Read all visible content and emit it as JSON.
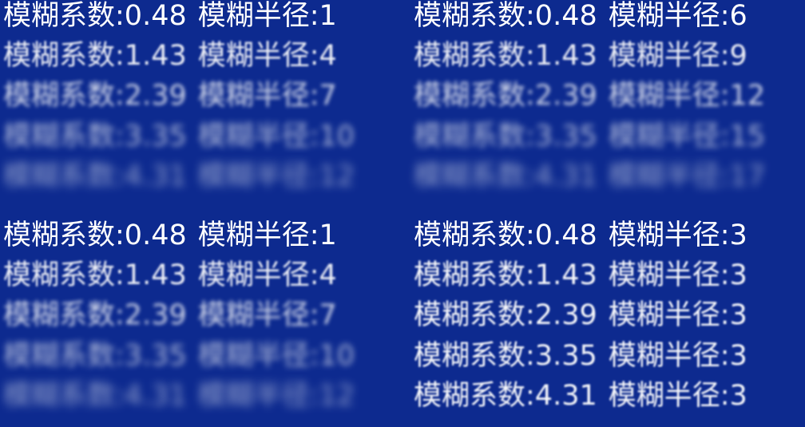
{
  "panels": [
    {
      "rows": [
        {
          "coef_label": "模糊系数:",
          "coef": "0.48",
          "radius_label": "模糊半径:",
          "radius": "1"
        },
        {
          "coef_label": "模糊系数:",
          "coef": "1.43",
          "radius_label": "模糊半径:",
          "radius": "4"
        },
        {
          "coef_label": "模糊系数:",
          "coef": "2.39",
          "radius_label": "模糊半径:",
          "radius": "7"
        },
        {
          "coef_label": "模糊系数:",
          "coef": "3.35",
          "radius_label": "模糊半径:",
          "radius": "10"
        },
        {
          "coef_label": "模糊系数:",
          "coef": "4.31",
          "radius_label": "模糊半径:",
          "radius": "12"
        }
      ]
    },
    {
      "rows": [
        {
          "coef_label": "模糊系数:",
          "coef": "0.48",
          "radius_label": "模糊半径:",
          "radius": "6"
        },
        {
          "coef_label": "模糊系数:",
          "coef": "1.43",
          "radius_label": "模糊半径:",
          "radius": "9"
        },
        {
          "coef_label": "模糊系数:",
          "coef": "2.39",
          "radius_label": "模糊半径:",
          "radius": "12"
        },
        {
          "coef_label": "模糊系数:",
          "coef": "3.35",
          "radius_label": "模糊半径:",
          "radius": "15"
        },
        {
          "coef_label": "模糊系数:",
          "coef": "4.31",
          "radius_label": "模糊半径:",
          "radius": "17"
        }
      ]
    },
    {
      "rows": [
        {
          "coef_label": "模糊系数:",
          "coef": "0.48",
          "radius_label": "模糊半径:",
          "radius": "1"
        },
        {
          "coef_label": "模糊系数:",
          "coef": "1.43",
          "radius_label": "模糊半径:",
          "radius": "4"
        },
        {
          "coef_label": "模糊系数:",
          "coef": "2.39",
          "radius_label": "模糊半径:",
          "radius": "7"
        },
        {
          "coef_label": "模糊系数:",
          "coef": "3.35",
          "radius_label": "模糊半径:",
          "radius": "10"
        },
        {
          "coef_label": "模糊系数:",
          "coef": "4.31",
          "radius_label": "模糊半径:",
          "radius": "12"
        }
      ]
    },
    {
      "rows": [
        {
          "coef_label": "模糊系数:",
          "coef": "0.48",
          "radius_label": "模糊半径:",
          "radius": "3"
        },
        {
          "coef_label": "模糊系数:",
          "coef": "1.43",
          "radius_label": "模糊半径:",
          "radius": "3"
        },
        {
          "coef_label": "模糊系数:",
          "coef": "2.39",
          "radius_label": "模糊半径:",
          "radius": "3"
        },
        {
          "coef_label": "模糊系数:",
          "coef": "3.35",
          "radius_label": "模糊半径:",
          "radius": "3"
        },
        {
          "coef_label": "模糊系数:",
          "coef": "4.31",
          "radius_label": "模糊半径:",
          "radius": "3"
        }
      ]
    }
  ],
  "colors": {
    "background": "#0d2a8f",
    "text": "#ffffff"
  }
}
